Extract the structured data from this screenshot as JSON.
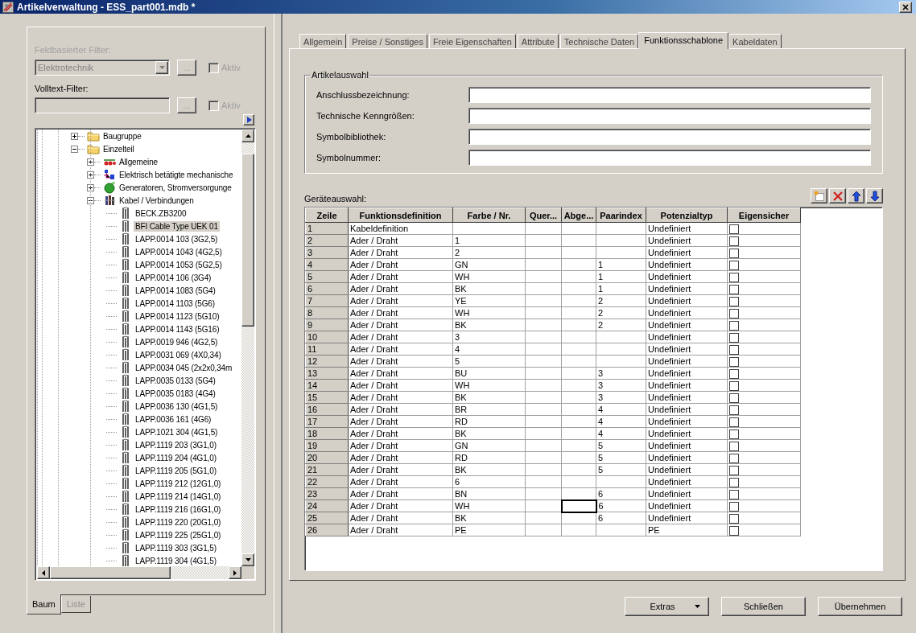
{
  "window": {
    "title": "Artikelverwaltung - ESS_part001.mdb *"
  },
  "filter": {
    "field_filter": {
      "label": "Feldbasierter Filter:",
      "value": "Elektrotechnik",
      "button": "...",
      "active_label": "Aktiv",
      "checked": false,
      "disabled": true
    },
    "fulltext_filter": {
      "label": "Volltext-Filter:",
      "button": "...",
      "active_label": "Aktiv",
      "checked": false,
      "disabled": true
    }
  },
  "tree": {
    "items": [
      {
        "label": "Baugruppe",
        "kind": "folder",
        "expanded": false,
        "selected": false
      },
      {
        "label": "Einzelteil",
        "kind": "folder",
        "expanded": true,
        "selected": false,
        "children": [
          {
            "label": "Allgemeine",
            "kind": "parts",
            "expanded": false,
            "selected": false
          },
          {
            "label": "Elektrisch betätigte mechanische",
            "kind": "relay",
            "expanded": false,
            "selected": false
          },
          {
            "label": "Generatoren, Stromversorgunge",
            "kind": "generator",
            "expanded": false,
            "selected": false
          },
          {
            "label": "Kabel / Verbindungen",
            "kind": "cable-group",
            "expanded": true,
            "selected": false,
            "children": [
              {
                "label": "BECK.ZB3200",
                "kind": "cable",
                "selected": false
              },
              {
                "label": "BFI Cable Type UEK 01",
                "kind": "cable",
                "selected": true
              },
              {
                "label": "LAPP.0014 103 (3G2,5)",
                "kind": "cable",
                "selected": false
              },
              {
                "label": "LAPP.0014 1043 (4G2,5)",
                "kind": "cable",
                "selected": false
              },
              {
                "label": "LAPP.0014 1053 (5G2,5)",
                "kind": "cable",
                "selected": false
              },
              {
                "label": "LAPP.0014 106 (3G4)",
                "kind": "cable",
                "selected": false
              },
              {
                "label": "LAPP.0014 1083 (5G4)",
                "kind": "cable",
                "selected": false
              },
              {
                "label": "LAPP.0014 1103 (5G6)",
                "kind": "cable",
                "selected": false
              },
              {
                "label": "LAPP.0014 1123 (5G10)",
                "kind": "cable",
                "selected": false
              },
              {
                "label": "LAPP.0014 1143 (5G16)",
                "kind": "cable",
                "selected": false
              },
              {
                "label": "LAPP.0019 946 (4G2,5)",
                "kind": "cable",
                "selected": false
              },
              {
                "label": "LAPP.0031 069 (4X0,34)",
                "kind": "cable",
                "selected": false
              },
              {
                "label": "LAPP.0034 045 (2x2x0,34m",
                "kind": "cable",
                "selected": false
              },
              {
                "label": "LAPP.0035 0133 (5G4)",
                "kind": "cable",
                "selected": false
              },
              {
                "label": "LAPP.0035 0183 (4G4)",
                "kind": "cable",
                "selected": false
              },
              {
                "label": "LAPP.0036 130 (4G1,5)",
                "kind": "cable",
                "selected": false
              },
              {
                "label": "LAPP.0036 161 (4G6)",
                "kind": "cable",
                "selected": false
              },
              {
                "label": "LAPP.1021 304 (4G1,5)",
                "kind": "cable",
                "selected": false
              },
              {
                "label": "LAPP.1119 203 (3G1,0)",
                "kind": "cable",
                "selected": false
              },
              {
                "label": "LAPP.1119 204 (4G1,0)",
                "kind": "cable",
                "selected": false
              },
              {
                "label": "LAPP.1119 205 (5G1,0)",
                "kind": "cable",
                "selected": false
              },
              {
                "label": "LAPP.1119 212 (12G1,0)",
                "kind": "cable",
                "selected": false
              },
              {
                "label": "LAPP.1119 214 (14G1,0)",
                "kind": "cable",
                "selected": false
              },
              {
                "label": "LAPP.1119 216 (16G1,0)",
                "kind": "cable",
                "selected": false
              },
              {
                "label": "LAPP.1119 220 (20G1,0)",
                "kind": "cable",
                "selected": false
              },
              {
                "label": "LAPP.1119 225 (25G1,0)",
                "kind": "cable",
                "selected": false
              },
              {
                "label": "LAPP.1119 303 (3G1,5)",
                "kind": "cable",
                "selected": false
              },
              {
                "label": "LAPP.1119 304 (4G1,5)",
                "kind": "cable",
                "selected": false
              }
            ]
          }
        ]
      }
    ]
  },
  "view_tabs": [
    {
      "label": "Baum",
      "selected": true
    },
    {
      "label": "Liste",
      "selected": false
    }
  ],
  "tabs": [
    {
      "label": "Allgemein",
      "selected": false
    },
    {
      "label": "Preise / Sonstiges",
      "selected": false
    },
    {
      "label": "Freie Eigenschaften",
      "selected": false
    },
    {
      "label": "Attribute",
      "selected": false
    },
    {
      "label": "Technische Daten",
      "selected": false
    },
    {
      "label": "Funktionsschablone",
      "selected": true
    },
    {
      "label": "Kabeldaten",
      "selected": false
    }
  ],
  "article_selection": {
    "title": "Artikelauswahl",
    "fields": [
      {
        "label": "Anschlussbezeichnung:"
      },
      {
        "label": "Technische Kenngrößen:"
      },
      {
        "label": "Symbolbibliothek:"
      },
      {
        "label": "Symbolnummer:"
      }
    ]
  },
  "device_selection": {
    "label": "Geräteauswahl:",
    "columns": [
      {
        "label": "Zeile"
      },
      {
        "label": "Funktionsdefinition"
      },
      {
        "label": "Farbe / Nr."
      },
      {
        "label": "Quer..."
      },
      {
        "label": "Abge..."
      },
      {
        "label": "Paarindex"
      },
      {
        "label": "Potenzialtyp"
      },
      {
        "label": "Eigensicher"
      }
    ],
    "rows": [
      {
        "zeile": "1",
        "funktionsdefinition": "Kabeldefinition",
        "potenzialtyp": "Undefiniert",
        "eigensicher": false,
        "focused": false
      },
      {
        "zeile": "2",
        "funktionsdefinition": "Ader / Draht",
        "farbe": "1",
        "potenzialtyp": "Undefiniert",
        "eigensicher": false,
        "focused": false
      },
      {
        "zeile": "3",
        "funktionsdefinition": "Ader / Draht",
        "farbe": "2",
        "potenzialtyp": "Undefiniert",
        "eigensicher": false,
        "focused": false
      },
      {
        "zeile": "4",
        "funktionsdefinition": "Ader / Draht",
        "farbe": "GN",
        "paarindex": "1",
        "potenzialtyp": "Undefiniert",
        "eigensicher": false,
        "focused": false
      },
      {
        "zeile": "5",
        "funktionsdefinition": "Ader / Draht",
        "farbe": "WH",
        "paarindex": "1",
        "potenzialtyp": "Undefiniert",
        "eigensicher": false,
        "focused": false
      },
      {
        "zeile": "6",
        "funktionsdefinition": "Ader / Draht",
        "farbe": "BK",
        "paarindex": "1",
        "potenzialtyp": "Undefiniert",
        "eigensicher": false,
        "focused": false
      },
      {
        "zeile": "7",
        "funktionsdefinition": "Ader / Draht",
        "farbe": "YE",
        "paarindex": "2",
        "potenzialtyp": "Undefiniert",
        "eigensicher": false,
        "focused": false
      },
      {
        "zeile": "8",
        "funktionsdefinition": "Ader / Draht",
        "farbe": "WH",
        "paarindex": "2",
        "potenzialtyp": "Undefiniert",
        "eigensicher": false,
        "focused": false
      },
      {
        "zeile": "9",
        "funktionsdefinition": "Ader / Draht",
        "farbe": "BK",
        "paarindex": "2",
        "potenzialtyp": "Undefiniert",
        "eigensicher": false,
        "focused": false
      },
      {
        "zeile": "10",
        "funktionsdefinition": "Ader / Draht",
        "farbe": "3",
        "potenzialtyp": "Undefiniert",
        "eigensicher": false,
        "focused": false
      },
      {
        "zeile": "11",
        "funktionsdefinition": "Ader / Draht",
        "farbe": "4",
        "potenzialtyp": "Undefiniert",
        "eigensicher": false,
        "focused": false
      },
      {
        "zeile": "12",
        "funktionsdefinition": "Ader / Draht",
        "farbe": "5",
        "potenzialtyp": "Undefiniert",
        "eigensicher": false,
        "focused": false
      },
      {
        "zeile": "13",
        "funktionsdefinition": "Ader / Draht",
        "farbe": "BU",
        "paarindex": "3",
        "potenzialtyp": "Undefiniert",
        "eigensicher": false,
        "focused": false
      },
      {
        "zeile": "14",
        "funktionsdefinition": "Ader / Draht",
        "farbe": "WH",
        "paarindex": "3",
        "potenzialtyp": "Undefiniert",
        "eigensicher": false,
        "focused": false
      },
      {
        "zeile": "15",
        "funktionsdefinition": "Ader / Draht",
        "farbe": "BK",
        "paarindex": "3",
        "potenzialtyp": "Undefiniert",
        "eigensicher": false,
        "focused": false
      },
      {
        "zeile": "16",
        "funktionsdefinition": "Ader / Draht",
        "farbe": "BR",
        "paarindex": "4",
        "potenzialtyp": "Undefiniert",
        "eigensicher": false,
        "focused": false
      },
      {
        "zeile": "17",
        "funktionsdefinition": "Ader / Draht",
        "farbe": "RD",
        "paarindex": "4",
        "potenzialtyp": "Undefiniert",
        "eigensicher": false,
        "focused": false
      },
      {
        "zeile": "18",
        "funktionsdefinition": "Ader / Draht",
        "farbe": "BK",
        "paarindex": "4",
        "potenzialtyp": "Undefiniert",
        "eigensicher": false,
        "focused": false
      },
      {
        "zeile": "19",
        "funktionsdefinition": "Ader / Draht",
        "farbe": "GN",
        "paarindex": "5",
        "potenzialtyp": "Undefiniert",
        "eigensicher": false,
        "focused": false
      },
      {
        "zeile": "20",
        "funktionsdefinition": "Ader / Draht",
        "farbe": "RD",
        "paarindex": "5",
        "potenzialtyp": "Undefiniert",
        "eigensicher": false,
        "focused": false
      },
      {
        "zeile": "21",
        "funktionsdefinition": "Ader / Draht",
        "farbe": "BK",
        "paarindex": "5",
        "potenzialtyp": "Undefiniert",
        "eigensicher": false,
        "focused": false
      },
      {
        "zeile": "22",
        "funktionsdefinition": "Ader / Draht",
        "farbe": "6",
        "potenzialtyp": "Undefiniert",
        "eigensicher": false,
        "focused": false
      },
      {
        "zeile": "23",
        "funktionsdefinition": "Ader / Draht",
        "farbe": "BN",
        "paarindex": "6",
        "potenzialtyp": "Undefiniert",
        "eigensicher": false,
        "focused": false
      },
      {
        "zeile": "24",
        "funktionsdefinition": "Ader / Draht",
        "farbe": "WH",
        "paarindex": "6",
        "potenzialtyp": "Undefiniert",
        "eigensicher": false,
        "focused": true
      },
      {
        "zeile": "25",
        "funktionsdefinition": "Ader / Draht",
        "farbe": "BK",
        "paarindex": "6",
        "potenzialtyp": "Undefiniert",
        "eigensicher": false,
        "focused": false
      },
      {
        "zeile": "26",
        "funktionsdefinition": "Ader / Draht",
        "farbe": "PE",
        "potenzialtyp": "PE",
        "eigensicher": false,
        "focused": false
      }
    ]
  },
  "buttons": [
    {
      "label": "Extras",
      "kind": "menu"
    },
    {
      "label": "Schließen",
      "kind": "plain"
    },
    {
      "label": "Übernehmen",
      "kind": "plain"
    }
  ]
}
